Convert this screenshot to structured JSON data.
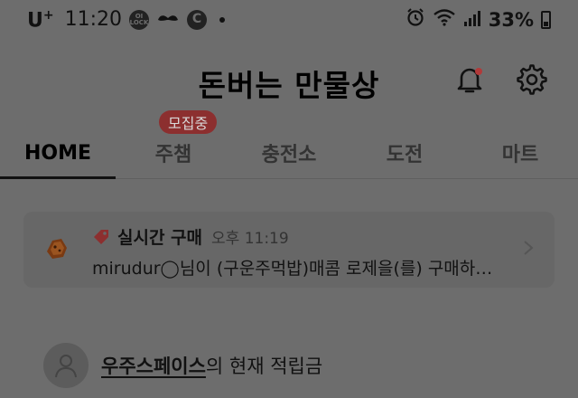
{
  "status_bar": {
    "carrier": "U",
    "carrier_super": "+",
    "time": "11:20",
    "badge_1": "OI LOCK",
    "badge_2_icon": "mustache-icon",
    "badge_3": "C",
    "battery": "33%"
  },
  "header": {
    "title": "돈버는 만물상"
  },
  "tabs": [
    {
      "label": "HOME"
    },
    {
      "label": "주챔"
    },
    {
      "label": "충전소"
    },
    {
      "label": "도전"
    },
    {
      "label": "마트"
    }
  ],
  "tab_badge": "모집중",
  "purchase": {
    "label": "실시간 구매",
    "time": "오후 11:19",
    "message": "mirudur◯님이 (구운주먹밥)매콤 로제을(를) 구매하…"
  },
  "points": {
    "user": "우주스페이스",
    "suffix": "의 현재 적립금"
  },
  "colors": {
    "background": "#6d6d6d",
    "badge": "#8c2f2f",
    "notification_dot": "#b23a3a"
  }
}
